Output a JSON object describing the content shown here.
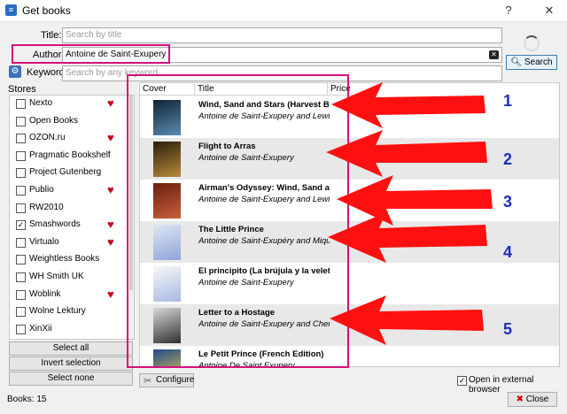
{
  "window": {
    "title": "Get books",
    "help_glyph": "?",
    "close_glyph": "✕"
  },
  "form": {
    "title_label": "Title:",
    "title_placeholder": "Search by title",
    "author_label": "Author:",
    "author_value": "Antoine de Saint-Exupery",
    "keyword_label": "Keyword:",
    "keyword_placeholder": "Search by any keyword",
    "search_label": "Search"
  },
  "stores": {
    "label": "Stores",
    "items": [
      {
        "name": "Nexto",
        "checked": false,
        "heart": true
      },
      {
        "name": "Open Books",
        "checked": false,
        "heart": false
      },
      {
        "name": "OZON.ru",
        "checked": false,
        "heart": true
      },
      {
        "name": "Pragmatic Bookshelf",
        "checked": false,
        "heart": false
      },
      {
        "name": "Project Gutenberg",
        "checked": false,
        "heart": false
      },
      {
        "name": "Publio",
        "checked": false,
        "heart": true
      },
      {
        "name": "RW2010",
        "checked": false,
        "heart": false
      },
      {
        "name": "Smashwords",
        "checked": true,
        "heart": true
      },
      {
        "name": "Virtualo",
        "checked": false,
        "heart": true
      },
      {
        "name": "Weightless Books",
        "checked": false,
        "heart": false
      },
      {
        "name": "WH Smith UK",
        "checked": false,
        "heart": false
      },
      {
        "name": "Woblink",
        "checked": false,
        "heart": true
      },
      {
        "name": "Wolne Lektury",
        "checked": false,
        "heart": false
      },
      {
        "name": "XinXii",
        "checked": false,
        "heart": false
      }
    ],
    "select_all": "Select all",
    "invert_selection": "Invert selection",
    "select_none": "Select none"
  },
  "books_count": "Books:  15",
  "results": {
    "columns": [
      "Cover",
      "Title",
      "Price"
    ],
    "rows": [
      {
        "title": "Wind, Sand and Stars (Harvest Book)",
        "author": "Antoine de Saint-Exupery and Lewis Galantière"
      },
      {
        "title": "Flight to Arras",
        "author": "Antoine de Saint-Exupery"
      },
      {
        "title": "Airman's Odyssey: Wind, Sand and Stars",
        "author": "Antoine de Saint-Exupery and Lewis Galantière"
      },
      {
        "title": "The Little Prince",
        "author": "Antoine de Saint-Exupéry and Miquême"
      },
      {
        "title": "El principito (La brújula y la veleta) (S",
        "author": "Antoine de Saint-Exupery"
      },
      {
        "title": "Letter to a Hostage",
        "author": "Antoine de Saint-Exupery and Cheryl Wa"
      },
      {
        "title": "Le Petit Prince (French Edition)",
        "author": "Antoine De Saint Exupery"
      }
    ]
  },
  "annotations": [
    "1",
    "2",
    "3",
    "4",
    "5"
  ],
  "bottom": {
    "configure_label": "Configure",
    "open_external_label": "Open in external browser",
    "open_external_checked": true,
    "close_label": "Close"
  },
  "colors": {
    "highlight": "#d4117d",
    "arrow": "#ff1010",
    "number": "#1d2ebe",
    "heart": "#c8001e"
  }
}
